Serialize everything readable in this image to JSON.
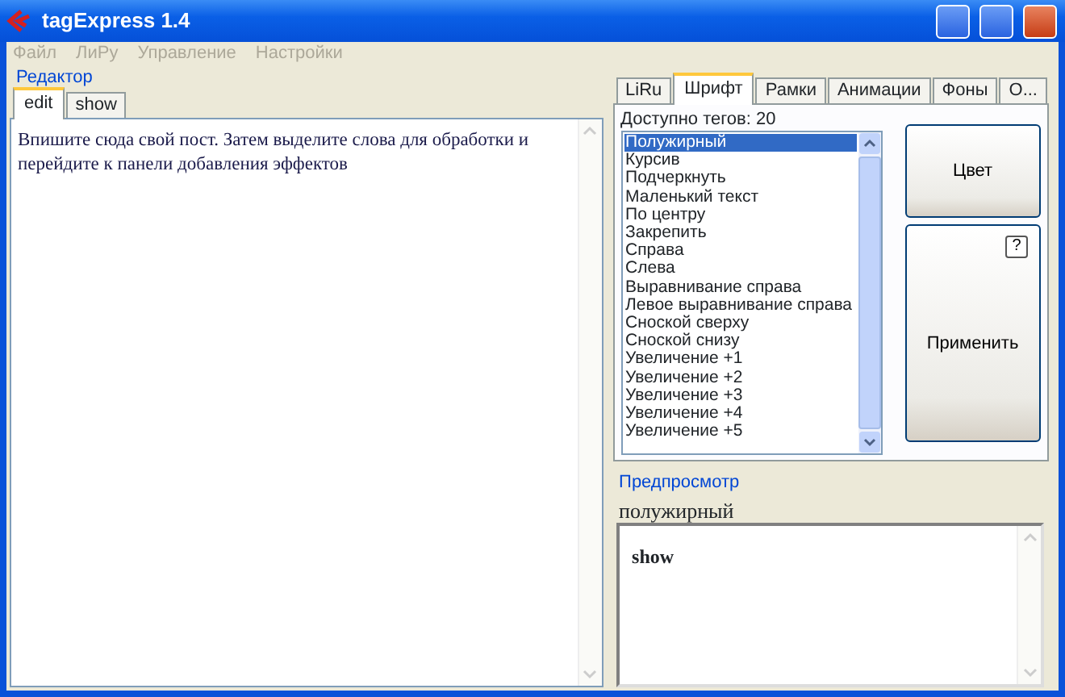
{
  "window": {
    "title": "tagExpress 1.4"
  },
  "menu": [
    {
      "label": "Файл",
      "disabled": true
    },
    {
      "label": "ЛиРу",
      "disabled": true
    },
    {
      "label": "Управление",
      "disabled": true
    },
    {
      "label": "Настройки",
      "disabled": true
    }
  ],
  "editor": {
    "group_label": "Редактор",
    "tabs": [
      {
        "label": "edit",
        "selected": true
      },
      {
        "label": "show",
        "selected": false
      }
    ],
    "text": "Впишите сюда свой пост. Затем выделите слова для обработки и перейдите к панели добавления эффектов"
  },
  "tag_panel": {
    "tabs": [
      {
        "label": "LiRu",
        "selected": false
      },
      {
        "label": "Шрифт",
        "selected": true
      },
      {
        "label": "Рамки",
        "selected": false
      },
      {
        "label": "Анимации",
        "selected": false
      },
      {
        "label": "Фоны",
        "selected": false
      },
      {
        "label": "О...",
        "selected": false
      }
    ],
    "count_label": "Доступно тегов: 20",
    "items": [
      {
        "label": "Полужирный",
        "selected": true
      },
      {
        "label": "Курсив",
        "selected": false
      },
      {
        "label": "Подчеркнуть",
        "selected": false
      },
      {
        "label": "Маленький текст",
        "selected": false
      },
      {
        "label": "По центру",
        "selected": false
      },
      {
        "label": "Закрепить",
        "selected": false
      },
      {
        "label": "Справа",
        "selected": false
      },
      {
        "label": "Слева",
        "selected": false
      },
      {
        "label": "Выравнивание справа",
        "selected": false
      },
      {
        "label": "Левое выравнивание справа",
        "selected": false
      },
      {
        "label": "Сноской сверху",
        "selected": false
      },
      {
        "label": "Сноской снизу",
        "selected": false
      },
      {
        "label": "Увеличение +1",
        "selected": false
      },
      {
        "label": "Увеличение +2",
        "selected": false
      },
      {
        "label": "Увеличение +3",
        "selected": false
      },
      {
        "label": "Увеличение +4",
        "selected": false
      },
      {
        "label": "Увеличение +5",
        "selected": false
      }
    ],
    "color_button": "Цвет",
    "apply_button": "Применить",
    "help_label": "?"
  },
  "preview": {
    "group_label": "Предпросмотр",
    "tag_name": "полужирный",
    "content": "show"
  }
}
